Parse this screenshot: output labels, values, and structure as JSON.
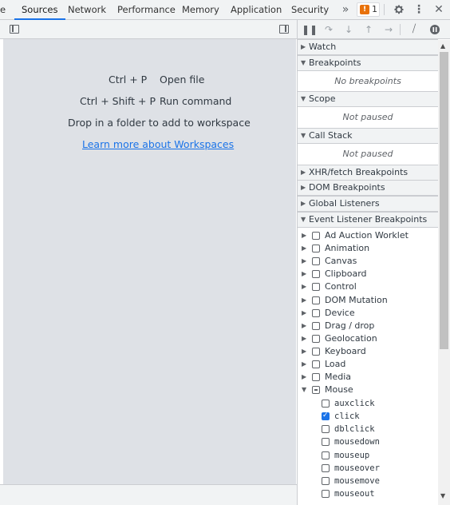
{
  "tabs": [
    {
      "label": "e",
      "active": false
    },
    {
      "label": "Sources",
      "active": true
    },
    {
      "label": "Network",
      "active": false
    },
    {
      "label": "Performance",
      "active": false
    },
    {
      "label": "Memory",
      "active": false
    },
    {
      "label": "Application",
      "active": false
    },
    {
      "label": "Security",
      "active": false
    }
  ],
  "toolbar": {
    "more_tabs": "»",
    "issues_count": "1",
    "settings_icon": "gear-icon",
    "menu_icon": "kebab-icon",
    "close": "✕"
  },
  "editor": {
    "shortcuts": [
      {
        "keys": "Ctrl + P",
        "command": "Open file"
      },
      {
        "keys": "Ctrl + Shift + P",
        "command": "Run command"
      }
    ],
    "drop_text": "Drop in a folder to add to workspace",
    "learn_link": "Learn more about Workspaces"
  },
  "sidebar": {
    "sections": {
      "watch": {
        "label": "Watch"
      },
      "breakpoints": {
        "label": "Breakpoints",
        "empty": "No breakpoints"
      },
      "scope": {
        "label": "Scope",
        "empty": "Not paused"
      },
      "callstack": {
        "label": "Call Stack",
        "empty": "Not paused"
      },
      "xhr": {
        "label": "XHR/fetch Breakpoints"
      },
      "dom": {
        "label": "DOM Breakpoints"
      },
      "global": {
        "label": "Global Listeners"
      },
      "elb": {
        "label": "Event Listener Breakpoints"
      }
    },
    "elb_items": [
      "Ad Auction Worklet",
      "Animation",
      "Canvas",
      "Clipboard",
      "Control",
      "DOM Mutation",
      "Device",
      "Drag / drop",
      "Geolocation",
      "Keyboard",
      "Load",
      "Media",
      "Mouse"
    ],
    "mouse_events": [
      {
        "label": "auxclick",
        "checked": false
      },
      {
        "label": "click",
        "checked": true
      },
      {
        "label": "dblclick",
        "checked": false
      },
      {
        "label": "mousedown",
        "checked": false
      },
      {
        "label": "mouseup",
        "checked": false
      },
      {
        "label": "mouseover",
        "checked": false
      },
      {
        "label": "mousemove",
        "checked": false
      },
      {
        "label": "mouseout",
        "checked": false
      }
    ]
  },
  "colors": {
    "accent": "#1a73e8",
    "warning": "#e8710a"
  }
}
